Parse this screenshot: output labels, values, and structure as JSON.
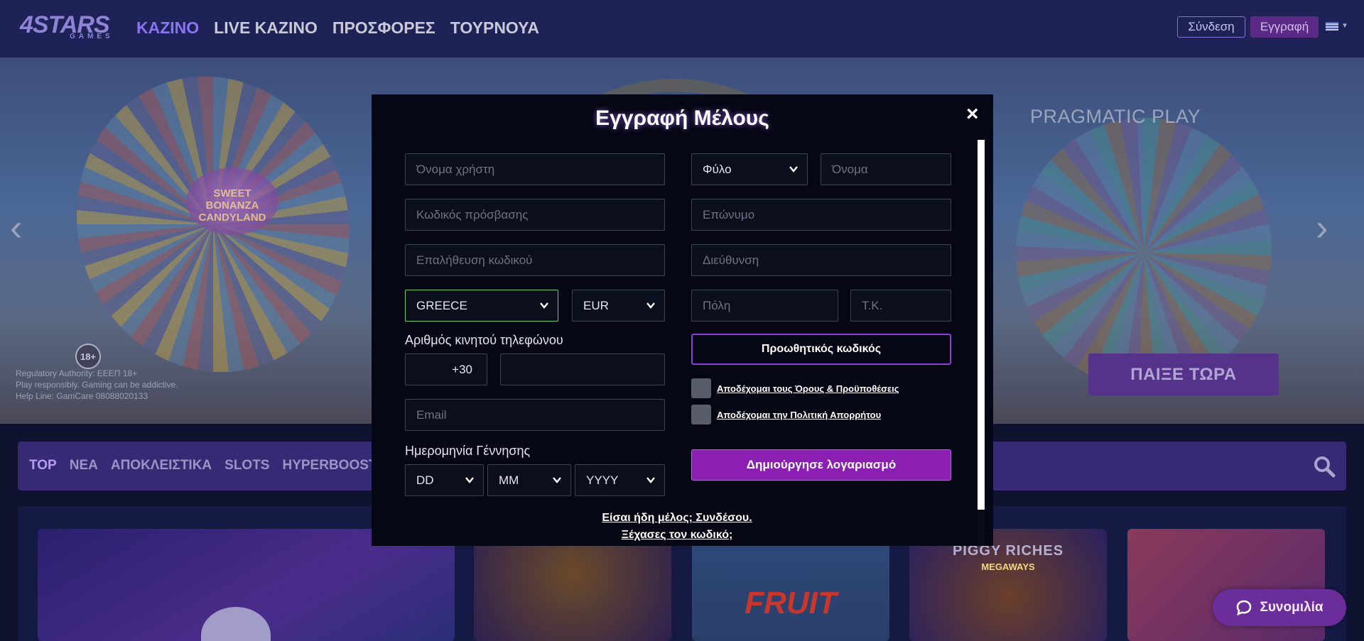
{
  "header": {
    "logo_main": "4STARS",
    "logo_sub": "GAMES",
    "nav": [
      {
        "label": "ΚΑΖΙΝΟ",
        "active": true
      },
      {
        "label": "LIVE ΚΑΖΙΝΟ",
        "active": false
      },
      {
        "label": "ΠΡΟΣΦΟΡΕΣ",
        "active": false
      },
      {
        "label": "ΤΟΥΡΝΟΥΑ",
        "active": false
      }
    ],
    "login_label": "Σύνδεση",
    "register_label": "Εγγραφή",
    "language_flag": "greek-flag-icon"
  },
  "hero": {
    "game_logo": "SWEET BONANZA CANDYLAND",
    "provider": "PRAGMATIC PLAY",
    "age_badge": "18+",
    "disclaimer": [
      "Regulatory Authority: ΕΕΕΠ 18+",
      "Play responsibly. Gaming can be addictive.",
      "Help Line: GamCare 08088020133"
    ],
    "play_button": "ΠΑΙΞΕ ΤΩΡΑ"
  },
  "categories": {
    "items": [
      {
        "label": "TOP",
        "active": true
      },
      {
        "label": "ΝΕΑ",
        "active": false
      },
      {
        "label": "ΑΠΟΚΛΕΙΣΤΙΚΑ",
        "active": false
      },
      {
        "label": "SLOTS",
        "active": false
      },
      {
        "label": "HYPERBOOST",
        "active": false
      }
    ]
  },
  "games": {
    "fruit_shop": "FRUIT",
    "piggy_riches": "PIGGY RICHES",
    "piggy_sub": "MEGAWAYS"
  },
  "chat": {
    "label": "Συνομιλία"
  },
  "modal": {
    "title": "Εγγραφή Μέλους",
    "close_label": "×",
    "username_placeholder": "Όνομα χρήστη",
    "password_placeholder": "Κωδικός πρόσβασης",
    "password_confirm_placeholder": "Επαλήθευση κωδικού",
    "country_value": "GREECE",
    "currency_value": "EUR",
    "phone_label": "Αριθμός κινητού τηλεφώνου",
    "phone_code": "+30",
    "phone_value": "",
    "email_placeholder": "Email",
    "dob_label": "Ημερομηνία Γέννησης",
    "dob_day": "DD",
    "dob_month": "MM",
    "dob_year": "YYYY",
    "gender_value": "Φύλο",
    "first_name_placeholder": "Όνομα",
    "last_name_placeholder": "Επώνυμο",
    "address_placeholder": "Διεύθυνση",
    "city_placeholder": "Πόλη",
    "postcode_placeholder": "Τ.Κ.",
    "promo_label": "Προωθητικός κωδικός",
    "terms_label": "Αποδέχομαι τους Όρους & Προϋποθέσεις",
    "privacy_label": "Αποδέχομαι την Πολιτική Απορρήτου",
    "create_label": "Δημιούργησε λογαριασμό",
    "already_member": "Είσαι ήδη μέλος; Συνδέσου.",
    "forgot_password": "Ξέχασες τον κωδικό;"
  },
  "colors": {
    "accent_purple": "#8b1fb2",
    "highlight_green": "#6dcc71",
    "modal_bg": "#050714"
  }
}
